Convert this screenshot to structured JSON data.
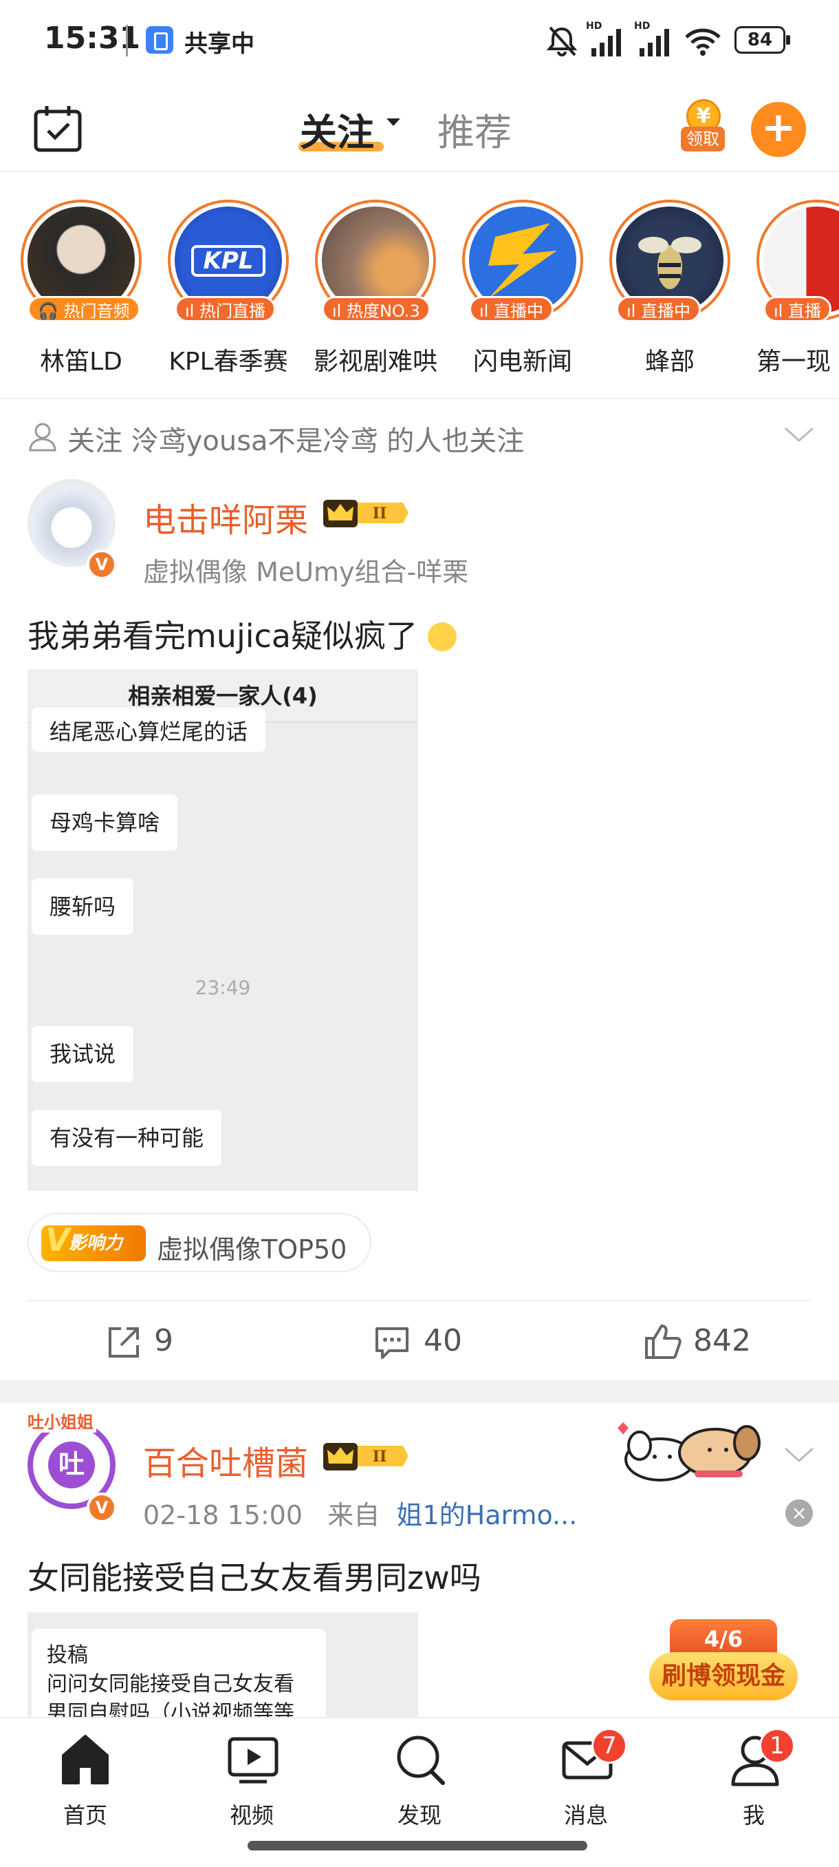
{
  "status_bar": {
    "time": "15:31",
    "share_label": "共享中",
    "battery": "84",
    "hd1": "HD",
    "hd2": "HD"
  },
  "top_nav": {
    "tab_follow": "关注",
    "tab_recommend": "推荐",
    "coupon_label": "领取",
    "coupon_symbol": "¥",
    "add_symbol": "+"
  },
  "stories": [
    {
      "name": "林笛LD",
      "badge": "热门音频",
      "badge_icon": "headphones-icon"
    },
    {
      "name": "KPL春季赛",
      "badge": "热门直播",
      "badge_icon": "live-bars-icon",
      "logo_text": "KPL"
    },
    {
      "name": "影视剧难哄",
      "badge": "热度NO.3",
      "badge_icon": "live-bars-icon"
    },
    {
      "name": "闪电新闻",
      "badge": "直播中",
      "badge_icon": "live-bars-icon"
    },
    {
      "name": "蜂部",
      "badge": "直播中",
      "badge_icon": "live-bars-icon"
    },
    {
      "name": "第一现",
      "badge": "直播",
      "badge_icon": "live-bars-icon"
    }
  ],
  "recommend_line": "关注 泠鸢yousa不是冷鸢 的人也关注",
  "post1": {
    "username": "电击咩阿栗",
    "level": "II",
    "verified": "V",
    "meta": "虚拟偶像 MeUmy组合-咩栗",
    "text": "我弟弟看完mujica疑似疯了",
    "chat": {
      "title": "相亲相爱一家人(4)",
      "bubbles": [
        "结尾恶心算烂尾的话",
        "母鸡卡算啥",
        "腰斩吗"
      ],
      "time": "23:49",
      "bubbles2": [
        "我试说",
        "有没有一种可能"
      ]
    },
    "topic_badge": "影响力",
    "topic_badge_v": "V",
    "topic_text": "虚拟偶像TOP50",
    "reposts": "9",
    "comments": "40",
    "likes": "842"
  },
  "post2": {
    "username": "百合吐槽菌",
    "level": "II",
    "avatar_char": "吐",
    "avatar_arc": "吐小姐姐",
    "verified": "V",
    "date": "02-18 15:00",
    "source_prefix": "来自",
    "source": "姐1的Harmo...",
    "text": "女同能接受自己女友看男同zw吗",
    "image_text": "投稿\n问问女同能接受自己女友看男同自慰吗（小说视频等等黄色",
    "close_symbol": "×"
  },
  "cash_badge": {
    "count": "4/6",
    "label": "刷博领现金"
  },
  "bottom_nav": [
    {
      "label": "首页",
      "icon": "home-icon"
    },
    {
      "label": "视频",
      "icon": "video-icon"
    },
    {
      "label": "发现",
      "icon": "search-icon"
    },
    {
      "label": "消息",
      "icon": "mail-icon",
      "badge": "7"
    },
    {
      "label": "我",
      "icon": "profile-icon",
      "badge": "1"
    }
  ],
  "colors": {
    "accent": "#ff8a1d",
    "username": "#e8602c",
    "badge_red": "#f2412f",
    "link": "#3b6fb6"
  }
}
